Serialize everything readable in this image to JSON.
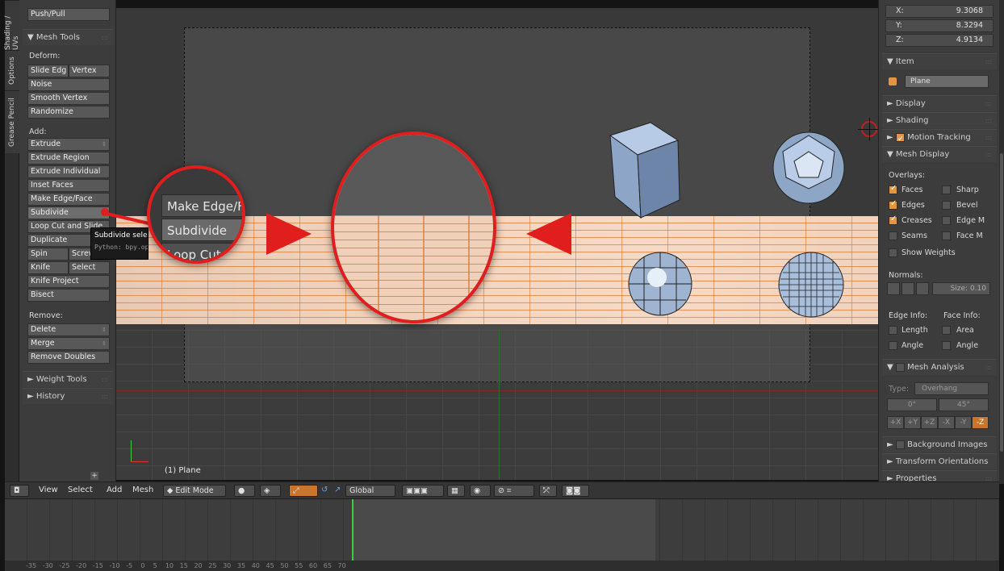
{
  "tabs": [
    "Shading / UVs",
    "Options",
    "Grease Pencil"
  ],
  "toolshelf": {
    "top_button": "Push/Pull",
    "mesh_tools_title": "Mesh Tools",
    "deform_label": "Deform:",
    "slide_edge": "Slide Edg",
    "vertex": "Vertex",
    "noise": "Noise",
    "smooth_vertex": "Smooth Vertex",
    "randomize": "Randomize",
    "add_label": "Add:",
    "extrude": "Extrude",
    "extrude_region": "Extrude Region",
    "extrude_individual": "Extrude Individual",
    "inset_faces": "Inset Faces",
    "make_edge_face": "Make Edge/Face",
    "subdivide": "Subdivide",
    "loop_cut": "Loop Cut and Slide",
    "duplicate": "Duplicate",
    "spin": "Spin",
    "screw": "Screw",
    "knife": "Knife",
    "select": "Select",
    "knife_project": "Knife Project",
    "bisect": "Bisect",
    "remove_label": "Remove:",
    "delete": "Delete",
    "merge": "Merge",
    "remove_doubles": "Remove Doubles",
    "weight_tools": "Weight Tools",
    "history": "History"
  },
  "tooltip": {
    "title": "Subdivide selected edges",
    "python": "Python: bpy.ops.mesh.subdivide()"
  },
  "magnifier": {
    "items": [
      "Make Edge/F",
      "Subdivide",
      "Loop Cut an"
    ]
  },
  "viewport": {
    "object_name": "(1) Plane"
  },
  "properties": {
    "coords": [
      {
        "label": "X:",
        "value": "9.3068"
      },
      {
        "label": "Y:",
        "value": "8.3294"
      },
      {
        "label": "Z:",
        "value": "4.9134"
      }
    ],
    "item_title": "Item",
    "item_name": "Plane",
    "display": "Display",
    "shading": "Shading",
    "motion_tracking": "Motion Tracking",
    "mesh_display": "Mesh Display",
    "overlays_label": "Overlays:",
    "faces": "Faces",
    "sharp": "Sharp",
    "edges": "Edges",
    "bevel": "Bevel",
    "creases": "Creases",
    "edge_m": "Edge M",
    "seams": "Seams",
    "face_m": "Face M",
    "show_weights": "Show Weights",
    "normals_label": "Normals:",
    "size": "Size: 0.10",
    "edge_info": "Edge Info:",
    "face_info": "Face Info:",
    "length": "Length",
    "area": "Area",
    "angle": "Angle",
    "angle2": "Angle",
    "mesh_analysis": "Mesh Analysis",
    "type_label": "Type:",
    "type_value": "Overhang",
    "range_min": "0°",
    "range_max": "45°",
    "axes": [
      "+X",
      "+Y",
      "+Z",
      "-X",
      "-Y",
      "-Z"
    ],
    "background_images": "Background Images",
    "transform_orientations": "Transform Orientations",
    "properties": "Properties"
  },
  "header": {
    "view": "View",
    "select": "Select",
    "add": "Add",
    "mesh": "Mesh",
    "mode": "Edit Mode",
    "orientation": "Global"
  },
  "timeline": {
    "ticks": "-35   -30   -25   -20   -15   -10   -5    0    5    10   15   20   25   30   35   40   45   50   55   60   65   70"
  },
  "colors": {
    "accent_red": "#e01e1e",
    "orange": "#e59442",
    "playhead": "#3ccf3c"
  }
}
